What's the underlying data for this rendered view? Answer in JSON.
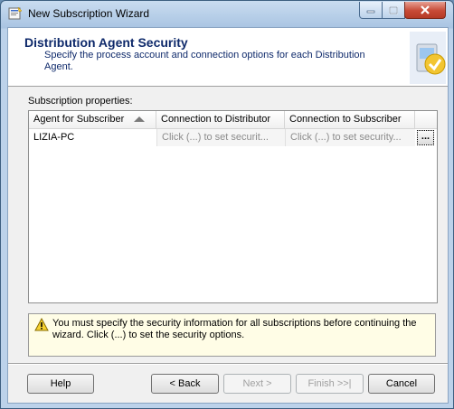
{
  "window": {
    "title": "New Subscription Wizard",
    "icon": "wizard-app-icon"
  },
  "header": {
    "title": "Distribution Agent Security",
    "description": "Specify the process account and connection options for each Distribution Agent.",
    "graphic": "wizard-graphic-icon"
  },
  "subscription_properties": {
    "label": "Subscription properties:",
    "columns": [
      "Agent for Subscriber",
      "Connection to Distributor",
      "Connection to Subscriber"
    ],
    "sort": {
      "column": "Agent for Subscriber",
      "direction": "ascending"
    },
    "rows": [
      {
        "agent": "LIZIA-PC",
        "distributor": "Click (...) to set securit...",
        "subscriber": "Click (...) to set security...",
        "button": "..."
      }
    ]
  },
  "warning": {
    "icon": "warning-icon",
    "text": "You must specify the security information for all subscriptions before continuing the wizard. Click (...) to set the security options."
  },
  "buttons": {
    "help": "Help",
    "back": "< Back",
    "next": "Next >",
    "finish": "Finish >>|",
    "cancel": "Cancel"
  },
  "colors": {
    "title_blue": "#0f2a6b",
    "warning_bg": "#fffde6",
    "close_red": "#c74a36"
  }
}
